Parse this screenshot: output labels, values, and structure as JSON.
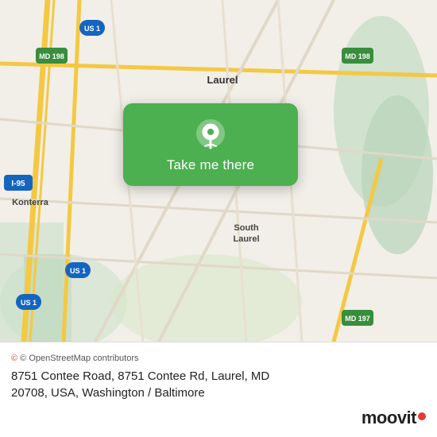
{
  "map": {
    "alt": "Map of Laurel MD area"
  },
  "popup": {
    "button_label": "Take me there"
  },
  "bottom_bar": {
    "osm_credit": "© OpenStreetMap contributors",
    "address_line1": "8751 Contee Road, 8751 Contee Rd, Laurel, MD",
    "address_line2": "20708, USA, Washington / Baltimore",
    "moovit_brand": "moovit"
  }
}
